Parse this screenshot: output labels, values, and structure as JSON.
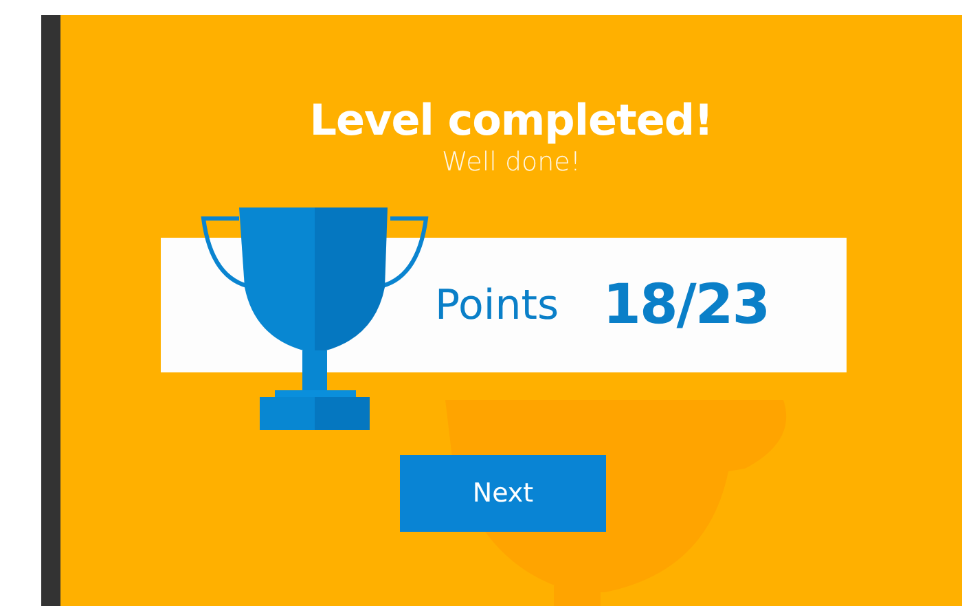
{
  "title": "Level completed!",
  "subtitle": "Well done!",
  "score": {
    "label": "Points",
    "value": "18/23"
  },
  "button": {
    "label": "Next"
  }
}
